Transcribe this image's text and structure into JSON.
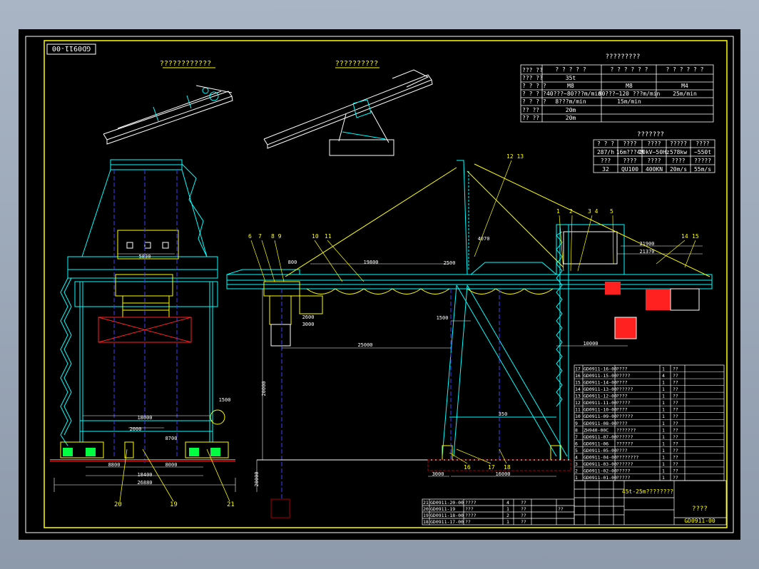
{
  "sheet": {
    "code_rotated": "GD0911-00"
  },
  "titles": {
    "left_view": "????????????",
    "center_view": "??????????"
  },
  "spec_table": {
    "title": "?????????",
    "r1": [
      "??? ??",
      "? ? ? ? ?",
      "? ? ? ? ? ?",
      "? ? ? ? ? ?"
    ],
    "r2": [
      "??? ??",
      "35t"
    ],
    "r3": [
      "? ? ? ?",
      "M8",
      "M8",
      "M4"
    ],
    "r4": [
      "? ? ? ?",
      "40???~80???m/min",
      "80???~120 ???m/min",
      "25m/min"
    ],
    "r5": [
      "? ? ? ?",
      "8???m/min",
      "15m/min"
    ],
    "r6": [
      "?? ??",
      "20m"
    ],
    "r7": [
      "?? ??",
      "20m"
    ]
  },
  "perf_table": {
    "title": "???????",
    "r1": [
      "? ? ?",
      "????",
      "????",
      "?????",
      "????"
    ],
    "r2": [
      "287/h",
      "16m???4M",
      "10kV~50Hz",
      "578kw",
      "~550t"
    ],
    "r3": [
      "???",
      "????",
      "????",
      "????",
      "?????"
    ],
    "r4": [
      "32",
      "QU100",
      "400KN",
      "20m/s",
      "55m/s"
    ]
  },
  "dims": {
    "end_view": {
      "d1": "5830",
      "d2": "18000",
      "d3": "2000",
      "d4": "8700",
      "d5": "8800",
      "d6": "8000",
      "d7": "18400",
      "d8": "26880",
      "d9": "1500"
    },
    "side_view": {
      "d1": "800",
      "d2": "19800",
      "d3": "2500",
      "d4": "25000",
      "d5": "1500",
      "d6": "10000",
      "d7": "21900",
      "d8": "21370",
      "d9": "16000",
      "d10": "3000",
      "d11": "350",
      "d12": "4070",
      "d13": "2600",
      "d14": "3000",
      "d15": "20000",
      "d16": "20000"
    }
  },
  "callouts": {
    "c1": "1",
    "c2": "2",
    "c3_4": "3 4",
    "c5": "5",
    "c6": "6",
    "c7": "7",
    "c8_9": "8 9",
    "c10": "10",
    "c11": "11",
    "c12_13": "12 13",
    "c14": "14",
    "c15": "15",
    "c16": "16",
    "c17": "17",
    "c18": "18",
    "c19": "19",
    "c20": "20",
    "c21": "21"
  },
  "parts_list": [
    [
      "17",
      "GD0911-16-00",
      "????",
      "1",
      "??"
    ],
    [
      "16",
      "GD0911-15-00",
      "?????",
      "4",
      "??"
    ],
    [
      "15",
      "GD0911-14-00",
      "????",
      "1",
      "??"
    ],
    [
      "14",
      "GD0911-13-00",
      "??????",
      "1",
      "??"
    ],
    [
      "13",
      "GD0911-12-00",
      "????",
      "1",
      "??"
    ],
    [
      "12",
      "GD0911-11-00",
      "?????",
      "1",
      "??"
    ],
    [
      "11",
      "GD0911-10-00",
      "????",
      "1",
      "??"
    ],
    [
      "10",
      "GD0911-09-00",
      "??????",
      "1",
      "??"
    ],
    [
      "9",
      "GD0911-08-00",
      "????",
      "1",
      "??"
    ],
    [
      "8",
      "ZH940-00C",
      "???????",
      "1",
      "??"
    ],
    [
      "7",
      "GD0911-07-00",
      "??????",
      "1",
      "??"
    ],
    [
      "6",
      "GD0911-06",
      "??????",
      "1",
      "??"
    ],
    [
      "5",
      "GD0911-05-00",
      "????",
      "1",
      "??"
    ],
    [
      "4",
      "GD0911-04-00",
      "????????",
      "1",
      "??"
    ],
    [
      "3",
      "GD0911-03-00",
      "??????",
      "1",
      "??"
    ],
    [
      "2",
      "GD0911-02-00",
      "?????",
      "1",
      "??"
    ],
    [
      "1",
      "GD0911-01-00",
      "?????",
      "1",
      "??"
    ]
  ],
  "parts_list_lower": [
    [
      "21",
      "GD0911-20-00",
      "????",
      "4",
      "??",
      ""
    ],
    [
      "20",
      "GD0911-19",
      "???",
      "1",
      "??",
      "??"
    ],
    [
      "19",
      "GD0911-18-00",
      "????",
      "2",
      "??",
      ""
    ],
    [
      "18",
      "GD0911-17-00",
      "??",
      "1",
      "??",
      ""
    ]
  ],
  "title_block": {
    "name": "45t-25m????????",
    "type": "????",
    "code": "GD0911-00"
  },
  "colors": {
    "canvas": "#000000",
    "frame": "#ffff00",
    "structure": "#00ffff",
    "centerline": "#4040ff",
    "hatch": "#ff2020"
  }
}
